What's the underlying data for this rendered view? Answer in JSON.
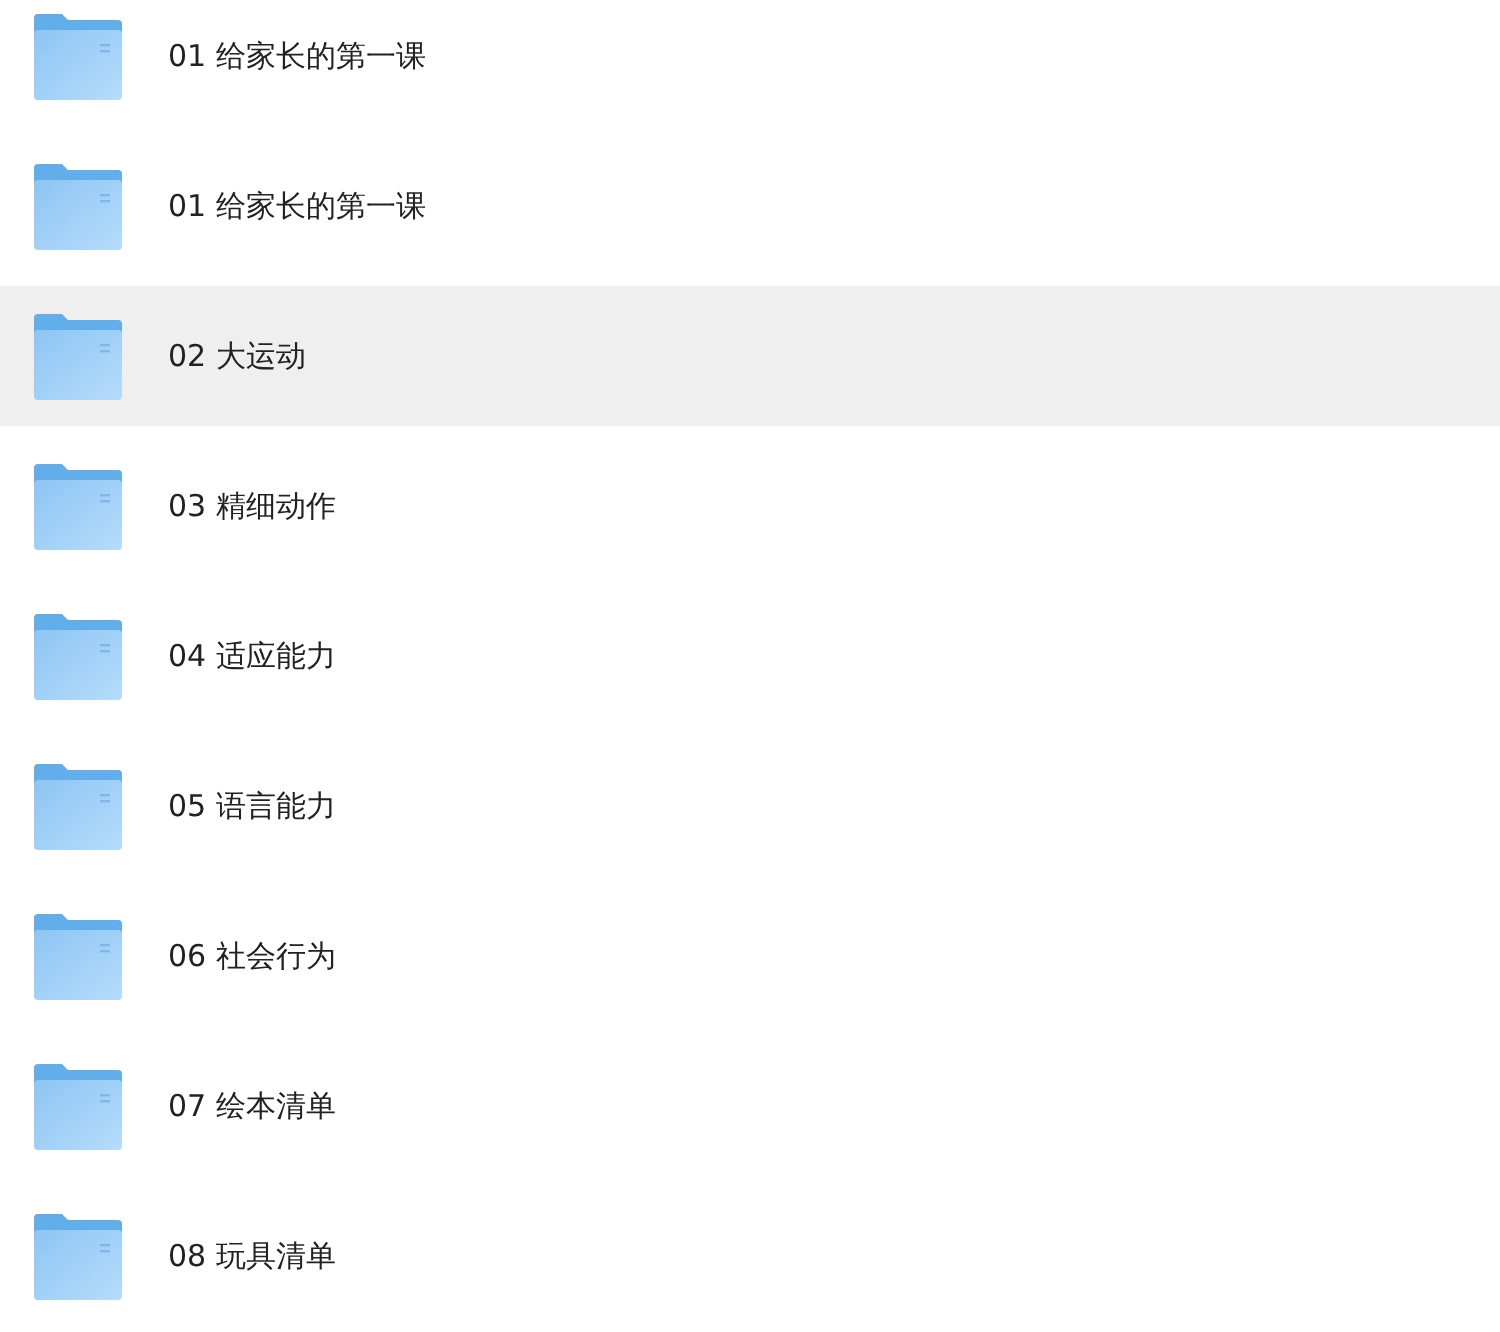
{
  "folders": [
    {
      "name": "01 给家长的第一课",
      "selected": false
    },
    {
      "name": "01 给家长的第一课",
      "selected": false
    },
    {
      "name": "02 大运动",
      "selected": true
    },
    {
      "name": "03 精细动作",
      "selected": false
    },
    {
      "name": "04 适应能力",
      "selected": false
    },
    {
      "name": "05 语言能力",
      "selected": false
    },
    {
      "name": "06 社会行为",
      "selected": false
    },
    {
      "name": "07 绘本清单",
      "selected": false
    },
    {
      "name": "08 玩具清单",
      "selected": false
    }
  ]
}
